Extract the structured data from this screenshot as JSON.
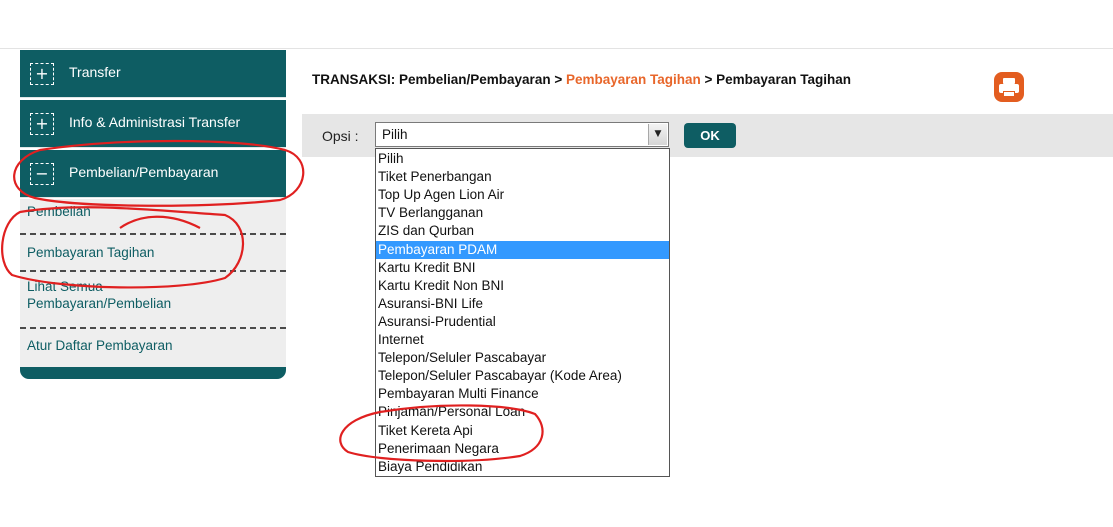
{
  "sidebar": {
    "menus": [
      {
        "label": "Transfer",
        "toggle": "+"
      },
      {
        "label": "Info & Administrasi Transfer",
        "toggle": "+"
      },
      {
        "label": "Pembelian/Pembayaran",
        "toggle": "−"
      }
    ],
    "submenu": [
      {
        "label": "Pembelian"
      },
      {
        "label": "Pembayaran Tagihan"
      },
      {
        "label_line1": "Lihat Semua",
        "label_line2": "Pembayaran/Pembelian"
      },
      {
        "label": "Atur Daftar Pembayaran"
      }
    ]
  },
  "breadcrumb": {
    "prefix": "TRANSAKSI: Pembelian/Pembayaran > ",
    "active": "Pembayaran Tagihan",
    "suffix": " > Pembayaran Tagihan"
  },
  "print_icon": "printer-icon",
  "options_bar": {
    "label": "Opsi :",
    "selected_value": "Pilih",
    "ok_label": "OK"
  },
  "dropdown": {
    "highlighted_index": 5,
    "items": [
      "Pilih",
      "Tiket Penerbangan",
      "Top Up Agen Lion Air",
      "TV Berlangganan",
      "ZIS dan Qurban",
      "Pembayaran PDAM",
      "Kartu Kredit BNI",
      "Kartu Kredit Non BNI",
      "Asuransi-BNI Life",
      "Asuransi-Prudential",
      "Internet",
      "Telepon/Seluler Pascabayar",
      "Telepon/Seluler Pascabayar (Kode Area)",
      "Pembayaran Multi Finance",
      "Pinjaman/Personal Loan",
      "Tiket Kereta Api",
      "Penerimaan Negara",
      "Biaya Pendidikan"
    ]
  },
  "colors": {
    "primary": "#0e5d63",
    "accent": "#e8662a",
    "highlight": "#3399ff",
    "annotation": "#e02020"
  }
}
